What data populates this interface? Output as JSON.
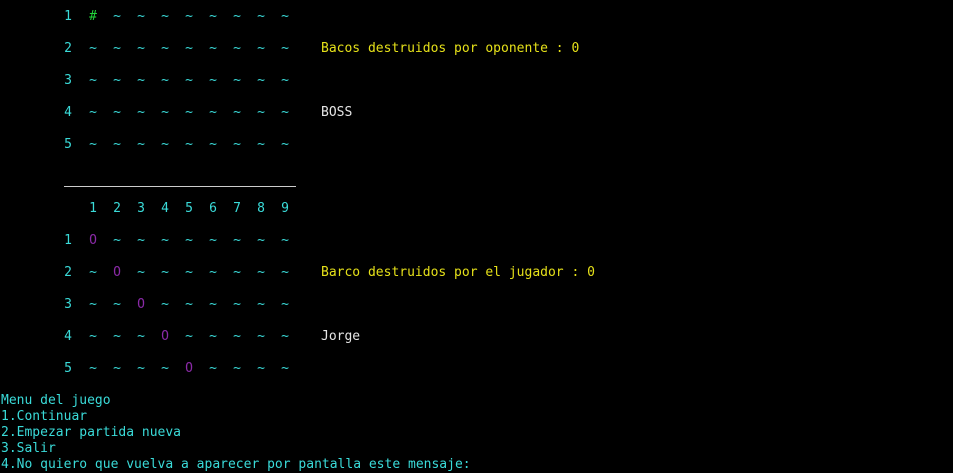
{
  "colors": {
    "water": "#3adbd9",
    "ship": "#22d63a",
    "hit": "#8b2aa8",
    "info": "#e5e019",
    "name": "#e6e6e6",
    "background": "#000000"
  },
  "boss_board": {
    "rows": [
      {
        "label": "1",
        "cells": [
          "#",
          "~",
          "~",
          "~",
          "~",
          "~",
          "~",
          "~",
          "~"
        ]
      },
      {
        "label": "2",
        "cells": [
          "~",
          "~",
          "~",
          "~",
          "~",
          "~",
          "~",
          "~",
          "~"
        ]
      },
      {
        "label": "3",
        "cells": [
          "~",
          "~",
          "~",
          "~",
          "~",
          "~",
          "~",
          "~",
          "~"
        ]
      },
      {
        "label": "4",
        "cells": [
          "~",
          "~",
          "~",
          "~",
          "~",
          "~",
          "~",
          "~",
          "~"
        ]
      },
      {
        "label": "5",
        "cells": [
          "~",
          "~",
          "~",
          "~",
          "~",
          "~",
          "~",
          "~",
          "~"
        ]
      }
    ],
    "destroyed_text": "Bacos destruidos por oponente : 0",
    "player_name": "BOSS"
  },
  "divider_text": "_______________________________",
  "column_headers": [
    "1",
    "2",
    "3",
    "4",
    "5",
    "6",
    "7",
    "8",
    "9"
  ],
  "player_board": {
    "rows": [
      {
        "label": "1",
        "cells": [
          "O",
          "~",
          "~",
          "~",
          "~",
          "~",
          "~",
          "~",
          "~"
        ]
      },
      {
        "label": "2",
        "cells": [
          "~",
          "O",
          "~",
          "~",
          "~",
          "~",
          "~",
          "~",
          "~"
        ]
      },
      {
        "label": "3",
        "cells": [
          "~",
          "~",
          "O",
          "~",
          "~",
          "~",
          "~",
          "~",
          "~"
        ]
      },
      {
        "label": "4",
        "cells": [
          "~",
          "~",
          "~",
          "O",
          "~",
          "~",
          "~",
          "~",
          "~"
        ]
      },
      {
        "label": "5",
        "cells": [
          "~",
          "~",
          "~",
          "~",
          "O",
          "~",
          "~",
          "~",
          "~"
        ]
      }
    ],
    "destroyed_text": "Barco destruidos por el jugador : 0",
    "player_name": "Jorge"
  },
  "menu": {
    "title": "Menu del juego",
    "options": [
      "1.Continuar",
      "2.Empezar partida nueva",
      "3.Salir",
      "4.No quiero que vuelva a aparecer por pantalla este mensaje:"
    ]
  }
}
